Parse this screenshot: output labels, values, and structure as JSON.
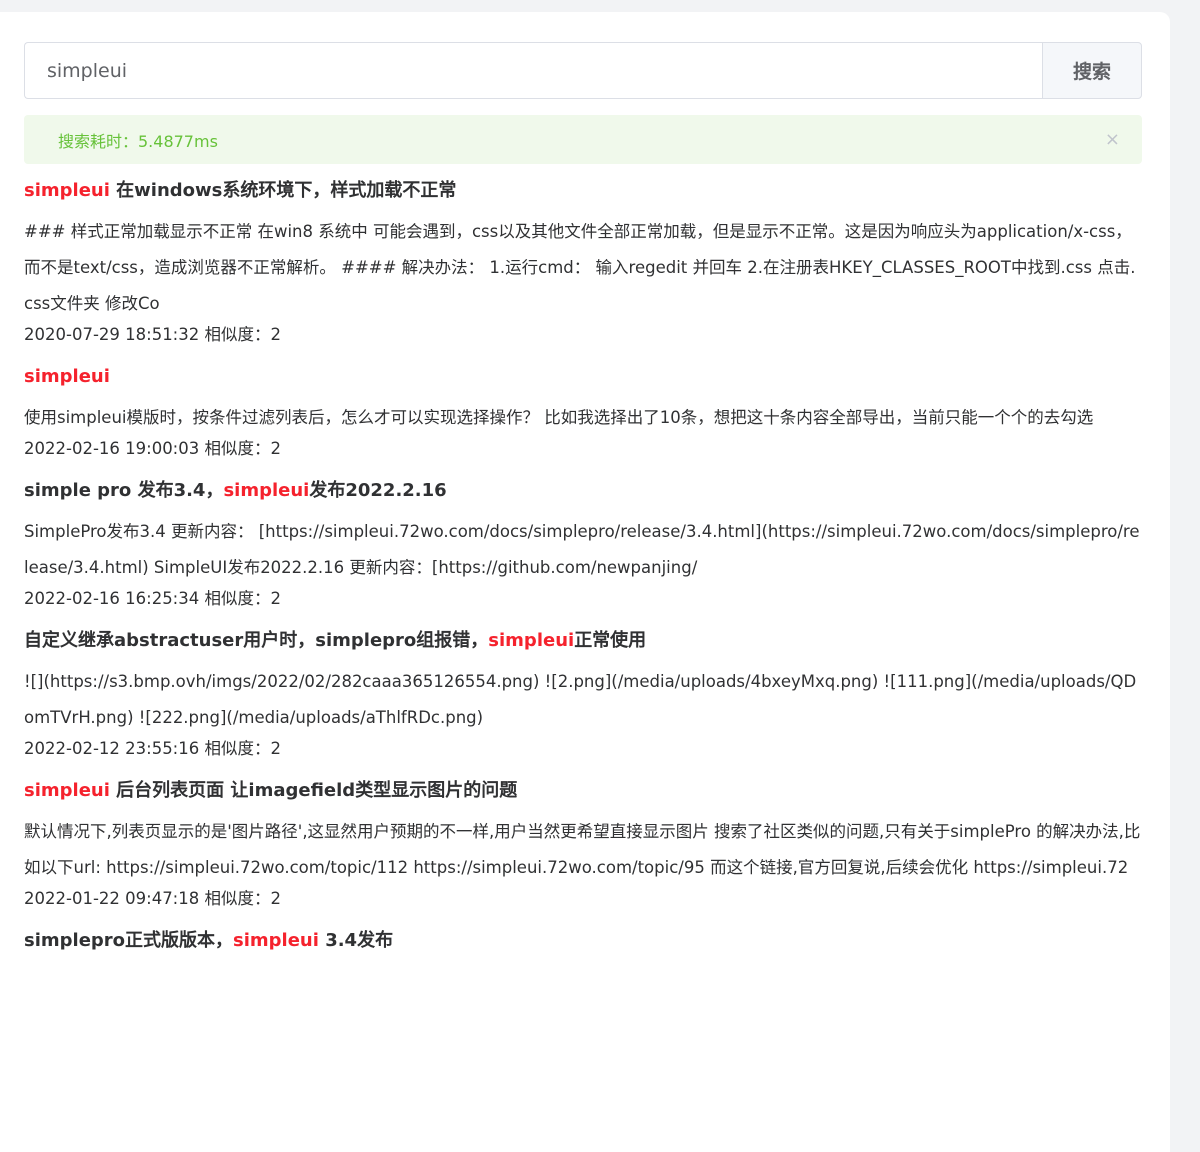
{
  "search": {
    "value": "simpleui",
    "button_label": "搜索"
  },
  "alert": {
    "text": "搜索耗时：5.4877ms",
    "close_glyph": "×"
  },
  "results": [
    {
      "title_pre": "",
      "title_hl": "simpleui",
      "title_post": " 在windows系统环境下，样式加载不正常",
      "snippet": "### 样式正常加载显示不正常 在win8 系统中 可能会遇到，css以及其他文件全部正常加载，但是显示不正常。这是因为响应头为application/x-css，而不是text/css，造成浏览器不正常解析。 #### 解决办法： 1.运行cmd： 输入regedit 并回车 2.在注册表HKEY_CLASSES_ROOT中找到.css 点击.css文件夹 修改Co",
      "meta": "2020-07-29 18:51:32 相似度：2"
    },
    {
      "title_pre": "",
      "title_hl": "simpleui",
      "title_post": "",
      "snippet": "使用simpleui模版时，按条件过滤列表后，怎么才可以实现选择操作？ 比如我选择出了10条，想把这十条内容全部导出，当前只能一个个的去勾选",
      "meta": "2022-02-16 19:00:03 相似度：2"
    },
    {
      "title_pre": "simple pro 发布3.4，",
      "title_hl": "simpleui",
      "title_post": "发布2022.2.16",
      "snippet": "SimplePro发布3.4 更新内容： [https://simpleui.72wo.com/docs/simplepro/release/3.4.html](https://simpleui.72wo.com/docs/simplepro/release/3.4.html) SimpleUI发布2022.2.16 更新内容：[https://github.com/newpanjing/",
      "meta": "2022-02-16 16:25:34 相似度：2"
    },
    {
      "title_pre": "自定义继承abstractuser用户时，simplepro组报错，",
      "title_hl": "simpleui",
      "title_post": "正常使用",
      "snippet": "![](https://s3.bmp.ovh/imgs/2022/02/282caaa365126554.png) ![2.png](/media/uploads/4bxeyMxq.png) ![111.png](/media/uploads/QDomTVrH.png) ![222.png](/media/uploads/aThlfRDc.png)",
      "meta": "2022-02-12 23:55:16 相似度：2"
    },
    {
      "title_pre": "",
      "title_hl": "simpleui",
      "title_post": " 后台列表页面 让imagefield类型显示图片的问题",
      "snippet": "默认情况下,列表页显示的是'图片路径',这显然用户预期的不一样,用户当然更希望直接显示图片 搜索了社区类似的问题,只有关于simplePro 的解决办法,比如以下url: https://simpleui.72wo.com/topic/112 https://simpleui.72wo.com/topic/95 而这个链接,官方回复说,后续会优化 https://simpleui.72",
      "meta": "2022-01-22 09:47:18 相似度：2"
    },
    {
      "title_pre": "simplepro正式版版本，",
      "title_hl": "simpleui",
      "title_post": " 3.4发布",
      "snippet": "",
      "meta": ""
    }
  ]
}
